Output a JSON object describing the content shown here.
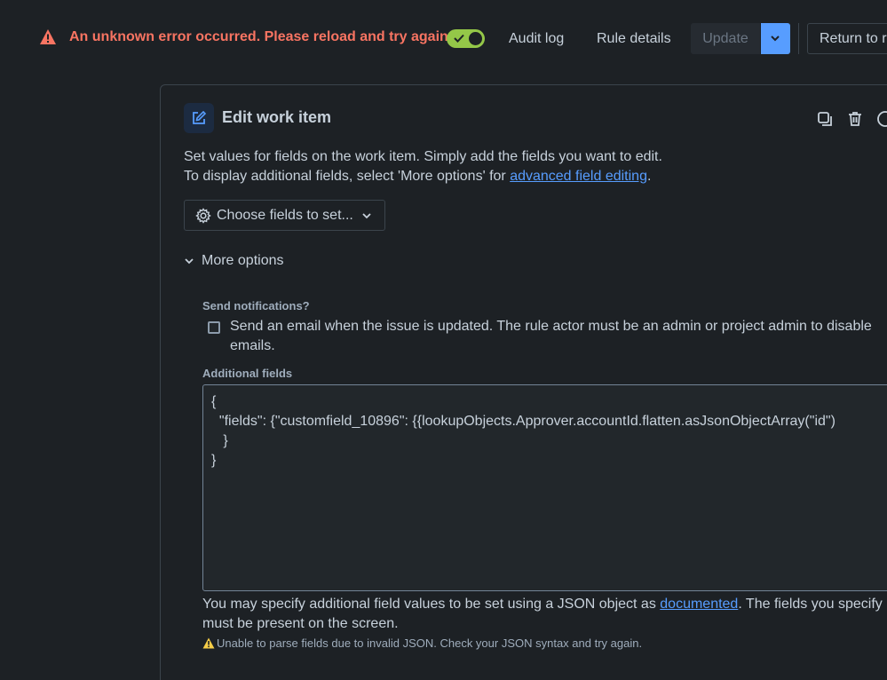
{
  "topbar": {
    "error_message": "An unknown error occurred. Please reload and try again.",
    "toggle_state": "on",
    "audit_log": "Audit log",
    "rule_details": "Rule details",
    "update": "Update",
    "return": "Return to r"
  },
  "card": {
    "title": "Edit work item",
    "desc_line1": "Set values for fields on the work item. Simply add the fields you want to edit.",
    "desc_line2_prefix": "To display additional fields, select 'More options' for ",
    "desc_link": "advanced field editing",
    "desc_line2_suffix": ".",
    "choose_fields": "Choose fields to set...",
    "more_options": "More options",
    "send_notifications_label": "Send notifications?",
    "send_email_text": "Send an email when the issue is updated. The rule actor must be an admin or project admin to disable emails.",
    "additional_fields_label": "Additional fields",
    "json_value": "{\n  \"fields\": {\"customfield_10896\": {{lookupObjects.Approver.accountId.flatten.asJsonObjectArray(\"id\")\n   }\n}",
    "help_prefix": "You may specify additional field values to be set using a JSON object as ",
    "help_link": "documented",
    "help_suffix": ". The fields you specify must be present on the screen.",
    "warning": "Unable to parse fields due to invalid JSON. Check your JSON syntax and try again."
  },
  "colors": {
    "error": "#f87462",
    "toggle": "#94c748",
    "accent": "#579dff",
    "warning": "#f5cd47"
  }
}
